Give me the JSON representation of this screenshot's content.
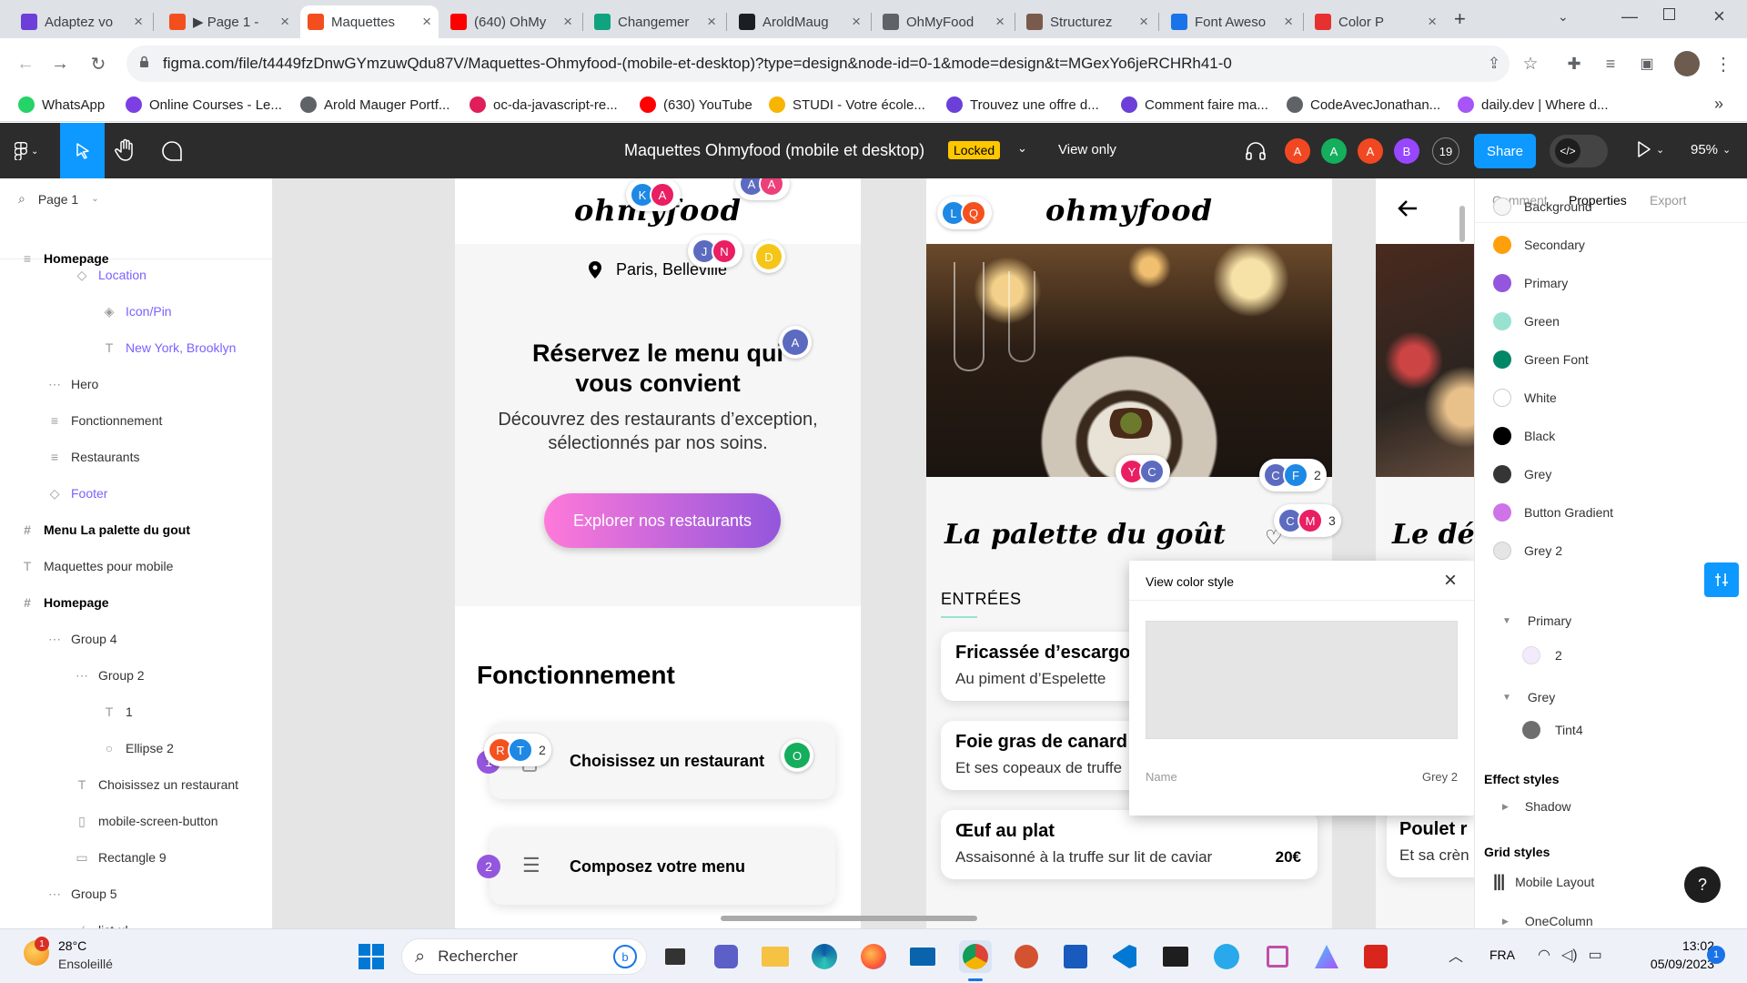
{
  "browser": {
    "tabs": [
      {
        "title": "Adaptez vo",
        "icon": "openclassrooms-icon",
        "color": "#6b3fd8"
      },
      {
        "title": "▶ Page 1 -",
        "icon": "figma-icon",
        "color": "#f24e1e"
      },
      {
        "title": "Maquettes",
        "icon": "figma-icon",
        "color": "#f24e1e",
        "active": true
      },
      {
        "title": "(640) OhMy",
        "icon": "youtube-icon",
        "color": "#ff0000"
      },
      {
        "title": "Changemer",
        "icon": "chatgpt-icon",
        "color": "#10a37f"
      },
      {
        "title": "AroldMaug",
        "icon": "github-icon",
        "color": "#1b1f23"
      },
      {
        "title": "OhMyFood",
        "icon": "globe-icon",
        "color": "#5f6368"
      },
      {
        "title": "Structurez",
        "icon": "avatar-icon",
        "color": "#7a5a4a"
      },
      {
        "title": "Font Aweso",
        "icon": "flag-icon",
        "color": "#1a73e8"
      },
      {
        "title": "Color P",
        "icon": "picker-icon",
        "color": "#e6312e"
      }
    ],
    "url": "figma.com/file/t4449fzDnwGYmzuwQdu87V/Maquettes-Ohmyfood-(mobile-et-desktop)?type=design&node-id=0-1&mode=design&t=MGexYo6jeRCHRh41-0",
    "bookmarks": [
      {
        "label": "WhatsApp",
        "color": "#25d366"
      },
      {
        "label": "Online Courses - Le...",
        "color": "#7b3fe4"
      },
      {
        "label": "Arold Mauger Portf...",
        "color": "#5f6368"
      },
      {
        "label": "oc-da-javascript-re...",
        "color": "#e01e5a"
      },
      {
        "label": "(630) YouTube",
        "color": "#ff0000"
      },
      {
        "label": "STUDI - Votre école...",
        "color": "#f7b500"
      },
      {
        "label": "Trouvez une offre d...",
        "color": "#6b3fd8"
      },
      {
        "label": "Comment faire ma...",
        "color": "#6b3fd8"
      },
      {
        "label": "CodeAvecJonathan...",
        "color": "#5f6368"
      },
      {
        "label": "daily.dev | Where d...",
        "color": "#a855f7"
      }
    ],
    "bookmarks_more": "»"
  },
  "figma": {
    "file_title": "Maquettes Ohmyfood (mobile et desktop)",
    "locked_badge": "Locked",
    "view_mode": "View only",
    "collaborators": [
      {
        "initial": "A",
        "color": "#f24822"
      },
      {
        "initial": "A",
        "color": "#14ae5c"
      },
      {
        "initial": "A",
        "color": "#f24822"
      },
      {
        "initial": "B",
        "color": "#9747ff"
      }
    ],
    "collaborator_count": "19",
    "share_label": "Share",
    "zoom": "95%"
  },
  "layers": {
    "page": "Page 1",
    "items": [
      {
        "label": "Homepage",
        "icon": "≡",
        "indent": 0,
        "style": "bold"
      },
      {
        "label": "Location",
        "icon": "◇",
        "indent": 2,
        "style": "comp"
      },
      {
        "label": "Icon/Pin",
        "icon": "◈",
        "indent": 3,
        "style": "comp"
      },
      {
        "label": "New York, Brooklyn",
        "icon": "T",
        "indent": 3,
        "style": "comp"
      },
      {
        "label": "Hero",
        "icon": "⋯",
        "indent": 1,
        "style": ""
      },
      {
        "label": "Fonctionnement",
        "icon": "≡",
        "indent": 1,
        "style": ""
      },
      {
        "label": "Restaurants",
        "icon": "≡",
        "indent": 1,
        "style": ""
      },
      {
        "label": "Footer",
        "icon": "◇",
        "indent": 1,
        "style": "comp"
      },
      {
        "label": "Menu La palette du gout",
        "icon": "#",
        "indent": 0,
        "style": "bold"
      },
      {
        "label": "Maquettes pour mobile",
        "icon": "T",
        "indent": 0,
        "style": ""
      },
      {
        "label": "Homepage",
        "icon": "#",
        "indent": 0,
        "style": "bold"
      },
      {
        "label": "Group 4",
        "icon": "⋯",
        "indent": 1,
        "style": ""
      },
      {
        "label": "Group 2",
        "icon": "⋯",
        "indent": 2,
        "style": ""
      },
      {
        "label": "1",
        "icon": "T",
        "indent": 3,
        "style": ""
      },
      {
        "label": "Ellipse 2",
        "icon": "○",
        "indent": 3,
        "style": ""
      },
      {
        "label": "Choisissez un restaurant",
        "icon": "T",
        "indent": 2,
        "style": ""
      },
      {
        "label": "mobile-screen-button",
        "icon": "▯",
        "indent": 2,
        "style": ""
      },
      {
        "label": "Rectangle 9",
        "icon": "▭",
        "indent": 2,
        "style": ""
      },
      {
        "label": "Group 5",
        "icon": "⋯",
        "indent": 1,
        "style": ""
      },
      {
        "label": "list-ul",
        "icon": "⁄",
        "indent": 2,
        "style": ""
      }
    ]
  },
  "canvas": {
    "home": {
      "brand": "ohmyfood",
      "location": "Paris, Belleville",
      "hero_title": "Réservez le menu qui vous convient",
      "hero_text": "Découvrez des restaurants d’exception, sélectionnés par nos soins.",
      "cta": "Explorer nos restaurants",
      "section_title": "Fonctionnement",
      "steps": [
        {
          "num": "1",
          "label": "Choisissez un restaurant"
        },
        {
          "num": "2",
          "label": "Composez votre menu"
        }
      ]
    },
    "menu": {
      "brand": "ohmyfood",
      "restaurant": "La palette du goût",
      "section": "ENTRÉES",
      "dishes": [
        {
          "name": "Fricassée d’escargo",
          "desc": "Au piment d’Espelette",
          "price": ""
        },
        {
          "name": "Foie gras de canard",
          "desc": "Et ses copeaux de truffe",
          "price": ""
        },
        {
          "name": "Œuf au plat",
          "desc": "Assaisonné à la truffe sur lit de caviar",
          "price": "20€"
        }
      ]
    },
    "third": {
      "title": "Le dé",
      "dish": "Poulet r",
      "desc": "Et sa crèn"
    },
    "cursors": {
      "a": [
        "K",
        "A"
      ],
      "b": [
        "A",
        "A"
      ],
      "c": [
        "J",
        "N"
      ],
      "d": "D",
      "e": "A",
      "f": [
        "L",
        "Q"
      ],
      "g": [
        "Y",
        "C"
      ],
      "h": [
        "C",
        "F"
      ],
      "h_count": "2",
      "i": [
        "C",
        "M"
      ],
      "i_count": "3",
      "j": [
        "R",
        "T"
      ],
      "j_count": "2",
      "k": "O"
    },
    "color_popup": {
      "title": "View color style",
      "name_label": "Name",
      "name_value": "Grey 2",
      "swatch": "#e5e5e5"
    }
  },
  "right_panel": {
    "tabs": [
      "Comment",
      "Properties",
      "Export"
    ],
    "active_tab": "Properties",
    "colors": [
      {
        "name": "Background",
        "color": "#f6f6f6"
      },
      {
        "name": "Secondary",
        "color": "#ff9f0a"
      },
      {
        "name": "Primary",
        "color": "#9356dc"
      },
      {
        "name": "Green",
        "color": "#99e2d0"
      },
      {
        "name": "Green Font",
        "color": "#008766"
      },
      {
        "name": "White",
        "color": "#ffffff"
      },
      {
        "name": "Black",
        "color": "#000000"
      },
      {
        "name": "Grey",
        "color": "#353535"
      },
      {
        "name": "Button Gradient",
        "color": "#ce74e6"
      },
      {
        "name": "Grey 2",
        "color": "#e5e5e5"
      }
    ],
    "groups": [
      {
        "name": "Primary",
        "child": "2",
        "child_color": "#f3eafc"
      },
      {
        "name": "Grey",
        "child": "Tint4",
        "child_color": "#6e6e6e"
      }
    ],
    "effect_title": "Effect styles",
    "effect_item": "Shadow",
    "grid_title": "Grid styles",
    "grid_items": [
      "Mobile Layout",
      "OneColumn"
    ],
    "help": "?"
  },
  "taskbar": {
    "weather_temp": "28°C",
    "weather_text": "Ensoleillé",
    "weather_badge": "1",
    "search": "Rechercher",
    "lang": "FRA",
    "time": "13:02",
    "date": "05/09/2023",
    "notif": "1"
  }
}
